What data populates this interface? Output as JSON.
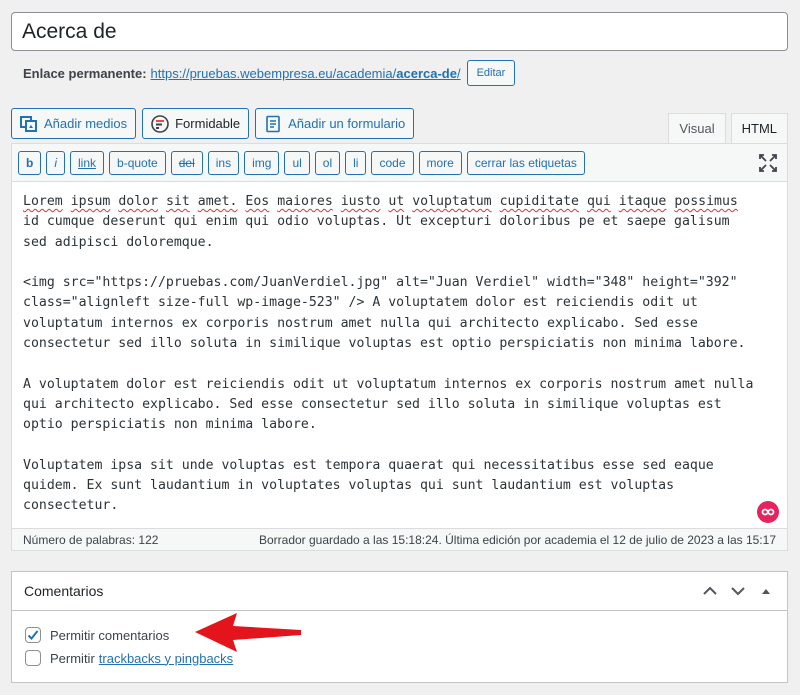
{
  "post": {
    "title": "Acerca de"
  },
  "permalink": {
    "label": "Enlace permanente:",
    "url_base": "https://pruebas.webempresa.eu/academia/",
    "url_slug": "acerca-de",
    "url_trailing": "/",
    "edit_label": "Editar"
  },
  "media_buttons": {
    "add_media": "Añadir medios",
    "formidable": "Formidable",
    "add_form": "Añadir un formulario"
  },
  "editor_tabs": {
    "visual": "Visual",
    "html": "HTML"
  },
  "quicktags": [
    "b",
    "i",
    "link",
    "b-quote",
    "del",
    "ins",
    "img",
    "ul",
    "ol",
    "li",
    "code",
    "more",
    "cerrar las etiquetas"
  ],
  "content": {
    "p1_line1_words": [
      "Lorem",
      "ipsum",
      "dolor",
      "sit",
      "amet.",
      "Eos",
      "maiores",
      "iusto",
      "ut",
      "voluptatum",
      "cupiditate",
      "qui",
      "itaque",
      "possimus"
    ],
    "p1_line2": "id cumque deserunt qui enim qui odio voluptas. Ut excepturi doloribus pe et saepe galisum",
    "p1_line3": "sed adipisci doloremque.",
    "p2": "<img src=\"https://pruebas.com/JuanVerdiel.jpg\" alt=\"Juan Verdiel\" width=\"348\" height=\"392\"\nclass=\"alignleft size-full wp-image-523\" /> A voluptatem dolor est reiciendis odit ut\nvoluptatum internos ex corporis nostrum amet nulla qui architecto explicabo. Sed esse\nconsectetur sed illo soluta in similique voluptas est optio perspiciatis non minima labore.",
    "p3": "A voluptatem dolor est reiciendis odit ut voluptatum internos ex corporis nostrum amet nulla\nqui architecto explicabo. Sed esse consectetur sed illo soluta in similique voluptas est\noptio perspiciatis non minima labore.",
    "p4": "Voluptatem ipsa sit unde voluptas est tempora quaerat qui necessitatibus esse sed eaque\nquidem. Ex sunt laudantium in voluptates voluptas qui sunt laudantium est voluptas\nconsectetur."
  },
  "status": {
    "word_count": "Número de palabras: 122",
    "autosave": "Borrador guardado a las 15:18:24. Última edición por academia el 12 de julio de 2023 a las 15:17"
  },
  "comments_box": {
    "title": "Comentarios",
    "allow_comments": "Permitir comentarios",
    "allow_comments_checked": true,
    "allow_pings_prefix": "Permitir",
    "allow_pings_link": "trackbacks y pingbacks",
    "allow_pings_checked": false
  },
  "colors": {
    "accent": "#2271b1",
    "annotation_arrow": "#e3141b",
    "grammarly": "#e5245e"
  },
  "icons": {
    "add_media": "media-icon",
    "formidable": "formidable-icon",
    "add_form": "form-icon",
    "fullscreen": "fullscreen-icon",
    "grammarly": "grammarly-icon",
    "move_up": "chevron-up-icon",
    "move_down": "chevron-down-icon",
    "toggle": "triangle-up-icon",
    "annotation": "red-arrow-icon"
  }
}
